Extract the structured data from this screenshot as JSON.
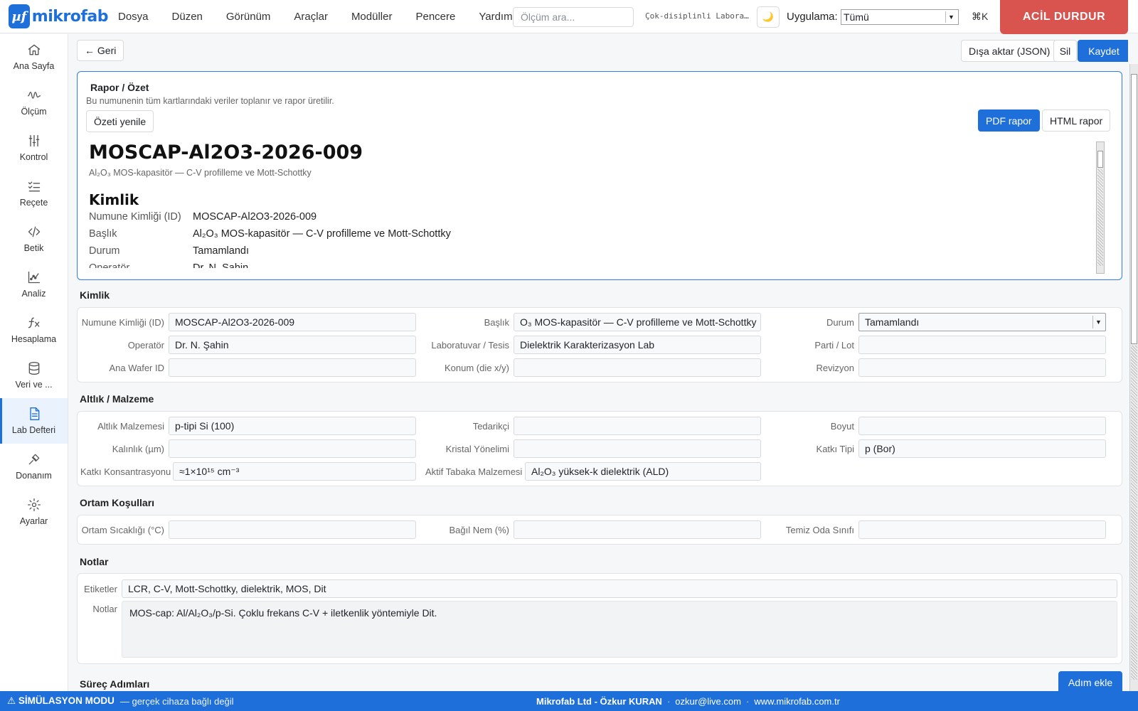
{
  "app": {
    "logo_symbol": "µf",
    "logo_text": "mikrofab",
    "menu": [
      "Dosya",
      "Düzen",
      "Görünüm",
      "Araçlar",
      "Modüller",
      "Pencere",
      "Yardım"
    ],
    "search_placeholder": "Ölçüm ara...",
    "workspace": "Çok-disiplinli Laboratuvar",
    "theme_icon": "moon-icon",
    "app_label": "Uygulama:",
    "app_value": "Tümü",
    "shortcut": "⌘K",
    "estop_label": "ACİL DURDUR",
    "accent": "#1e6fd9",
    "danger": "#d9534f"
  },
  "sidebar": {
    "items": [
      {
        "label": "Ana Sayfa",
        "icon": "home-icon"
      },
      {
        "label": "Ölçüm",
        "icon": "waveform-icon"
      },
      {
        "label": "Kontrol",
        "icon": "sliders-icon"
      },
      {
        "label": "Reçete",
        "icon": "checklist-icon"
      },
      {
        "label": "Betik",
        "icon": "code-icon"
      },
      {
        "label": "Analiz",
        "icon": "chart-icon"
      },
      {
        "label": "Hesaplama",
        "icon": "function-icon"
      },
      {
        "label": "Veri ve ...",
        "icon": "database-icon"
      },
      {
        "label": "Lab Defteri",
        "icon": "notebook-icon",
        "active": true
      },
      {
        "label": "Donanım",
        "icon": "probe-icon"
      },
      {
        "label": "Ayarlar",
        "icon": "gear-icon"
      }
    ]
  },
  "toolbar": {
    "back": "← Geri",
    "export": "Dışa aktar (JSON)",
    "delete": "Sil",
    "save": "Kaydet"
  },
  "report": {
    "title": "Rapor / Özet",
    "description": "Bu numunenin tüm kartlarındaki veriler toplanır ve rapor üretilir.",
    "refresh": "Özeti yenile",
    "pdf": "PDF rapor",
    "html": "HTML rapor",
    "preview": {
      "heading": "MOSCAP-Al2O3-2026-009",
      "subtitle": "Al₂O₃ MOS-kapasitör — C-V profilleme ve Mott-Schottky",
      "section": "Kimlik",
      "rows": [
        {
          "k": "Numune Kimliği (ID)",
          "v": "MOSCAP-Al2O3-2026-009"
        },
        {
          "k": "Başlık",
          "v": "Al₂O₃ MOS-kapasitör — C-V profilleme ve Mott-Schottky"
        },
        {
          "k": "Durum",
          "v": "Tamamlandı"
        },
        {
          "k": "Operatör",
          "v": "Dr. N. Şahin"
        }
      ]
    }
  },
  "sections": {
    "identity": {
      "title": "Kimlik",
      "sample_id_label": "Numune Kimliği (ID)",
      "sample_id": "MOSCAP-Al2O3-2026-009",
      "title_label": "Başlık",
      "title_value": "O₃ MOS-kapasitör — C-V profilleme ve Mott-Schottky",
      "status_label": "Durum",
      "status_value": "Tamamlandı",
      "operator_label": "Operatör",
      "operator": "Dr. N. Şahin",
      "lab_label": "Laboratuvar / Tesis",
      "lab": "Dielektrik Karakterizasyon Lab",
      "lot_label": "Parti / Lot",
      "lot": "",
      "wafer_label": "Ana Wafer ID",
      "wafer": "",
      "location_label": "Konum (die x/y)",
      "location": "",
      "revision_label": "Revizyon",
      "revision": ""
    },
    "substrate": {
      "title": "Altlık / Malzeme",
      "material_label": "Altlık Malzemesi",
      "material": "p-tipi Si (100)",
      "supplier_label": "Tedarikçi",
      "supplier": "",
      "size_label": "Boyut",
      "size": "",
      "thickness_label": "Kalınlık (µm)",
      "thickness": "",
      "orientation_label": "Kristal Yönelimi",
      "orientation": "",
      "dopant_type_label": "Katkı Tipi",
      "dopant_type": "p (Bor)",
      "dopant_conc_label": "Katkı Konsantrasyonu",
      "dopant_conc": "≈1×10¹⁵ cm⁻³",
      "active_layer_label": "Aktif Tabaka Malzemesi",
      "active_layer": "Al₂O₃ yüksek-k dielektrik (ALD)"
    },
    "environment": {
      "title": "Ortam Koşulları",
      "temp_label": "Ortam Sıcaklığı (°C)",
      "temp": "",
      "humidity_label": "Bağıl Nem (%)",
      "humidity": "",
      "cleanroom_label": "Temiz Oda Sınıfı",
      "cleanroom": ""
    },
    "notes": {
      "title": "Notlar",
      "tags_label": "Etiketler",
      "tags": "LCR, C-V, Mott-Schottky, dielektrik, MOS, Dit",
      "notes_label": "Notlar",
      "notes": "MOS-cap: Al/Al₂O₃/p-Si. Çoklu frekans C-V + iletkenlik yöntemiyle Dit."
    },
    "process": {
      "title": "Süreç Adımları",
      "add_step": "Adım ekle"
    }
  },
  "statusbar": {
    "mode": "⚠ SİMÜLASYON MODU",
    "mode_note": "— gerçek cihaza bağlı değil",
    "company": "Mikrofab Ltd - Özkur KURAN",
    "email": "ozkur@live.com",
    "website": "www.mikrofab.com.tr",
    "separator": "·"
  }
}
